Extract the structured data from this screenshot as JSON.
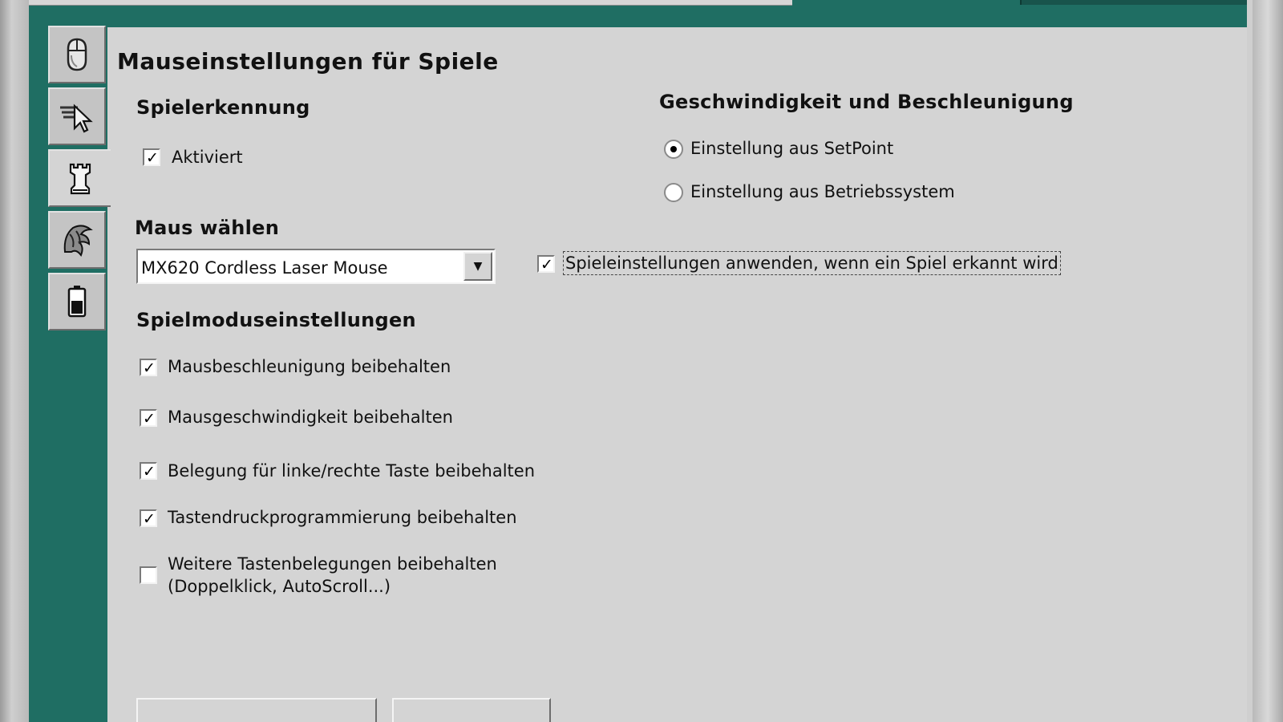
{
  "page": {
    "title": "Mauseinstellungen für Spiele"
  },
  "sidebar": {
    "icons": [
      {
        "name": "mouse-icon",
        "active": false
      },
      {
        "name": "pointer-icon",
        "active": false
      },
      {
        "name": "chess-rook-icon",
        "active": true
      },
      {
        "name": "dragon-icon",
        "active": false
      },
      {
        "name": "battery-icon",
        "active": false
      }
    ]
  },
  "detection": {
    "heading": "Spielerkennung",
    "enabled_label": "Aktiviert",
    "enabled_checked": true
  },
  "mouse_select": {
    "heading": "Maus wählen",
    "selected": "MX620 Cordless Laser Mouse"
  },
  "mode": {
    "heading": "Spielmoduseinstellungen",
    "options": [
      {
        "label": "Mausbeschleunigung beibehalten",
        "checked": true
      },
      {
        "label": "Mausgeschwindigkeit beibehalten",
        "checked": true
      },
      {
        "label": "Belegung für linke/rechte Taste beibehalten",
        "checked": true
      },
      {
        "label": "Tastendruckprogrammierung beibehalten",
        "checked": true
      },
      {
        "label_line1": "Weitere Tastenbelegungen beibehalten",
        "label_line2": "(Doppelklick, AutoScroll...)",
        "checked": false
      }
    ]
  },
  "speed": {
    "heading": "Geschwindigkeit und Beschleunigung",
    "options": [
      {
        "label": "Einstellung aus SetPoint",
        "selected": true
      },
      {
        "label": "Einstellung aus Betriebssystem",
        "selected": false
      }
    ]
  },
  "apply": {
    "label": "Spieleinstellungen anwenden, wenn ein Spiel erkannt wird",
    "checked": true
  },
  "colors": {
    "frame": "#1f6e63",
    "panel": "#d4d4d4"
  }
}
